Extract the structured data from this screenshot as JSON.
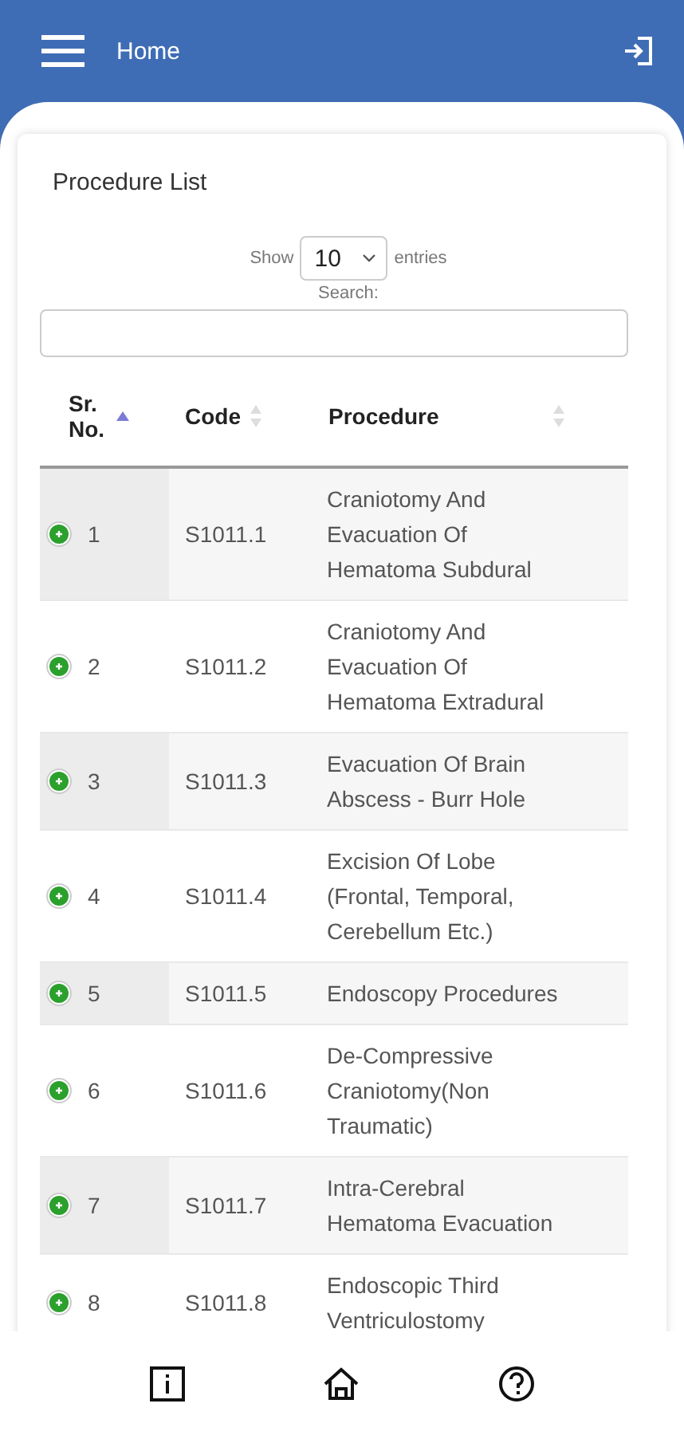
{
  "header": {
    "title": "Home"
  },
  "card": {
    "title": "Procedure List",
    "length_label_before": "Show",
    "length_value": "10",
    "length_label_after": "entries",
    "search_label": "Search:"
  },
  "table": {
    "columns": [
      {
        "label": "Sr. No.",
        "sorted": true
      },
      {
        "label": "Code",
        "sorted": false
      },
      {
        "label": "Procedure",
        "sorted": false
      }
    ],
    "rows": [
      {
        "sr": "1",
        "code": "S1011.1",
        "procedure": "Craniotomy And Evacuation Of Hematoma Subdural"
      },
      {
        "sr": "2",
        "code": "S1011.2",
        "procedure": "Craniotomy And Evacuation Of Hematoma Extradural"
      },
      {
        "sr": "3",
        "code": "S1011.3",
        "procedure": "Evacuation Of Brain Abscess - Burr Hole"
      },
      {
        "sr": "4",
        "code": "S1011.4",
        "procedure": "Excision Of Lobe (Frontal, Temporal, Cerebellum Etc.)"
      },
      {
        "sr": "5",
        "code": "S1011.5",
        "procedure": "Endoscopy Procedures"
      },
      {
        "sr": "6",
        "code": "S1011.6",
        "procedure": "De-Compressive Craniotomy(Non Traumatic)"
      },
      {
        "sr": "7",
        "code": "S1011.7",
        "procedure": "Intra-Cerebral Hematoma Evacuation"
      },
      {
        "sr": "8",
        "code": "S1011.8",
        "procedure": "Endoscopic Third Ventriculostomy"
      }
    ]
  },
  "bottom_nav": [
    {
      "kind": "info"
    },
    {
      "kind": "home"
    },
    {
      "kind": "help"
    }
  ]
}
